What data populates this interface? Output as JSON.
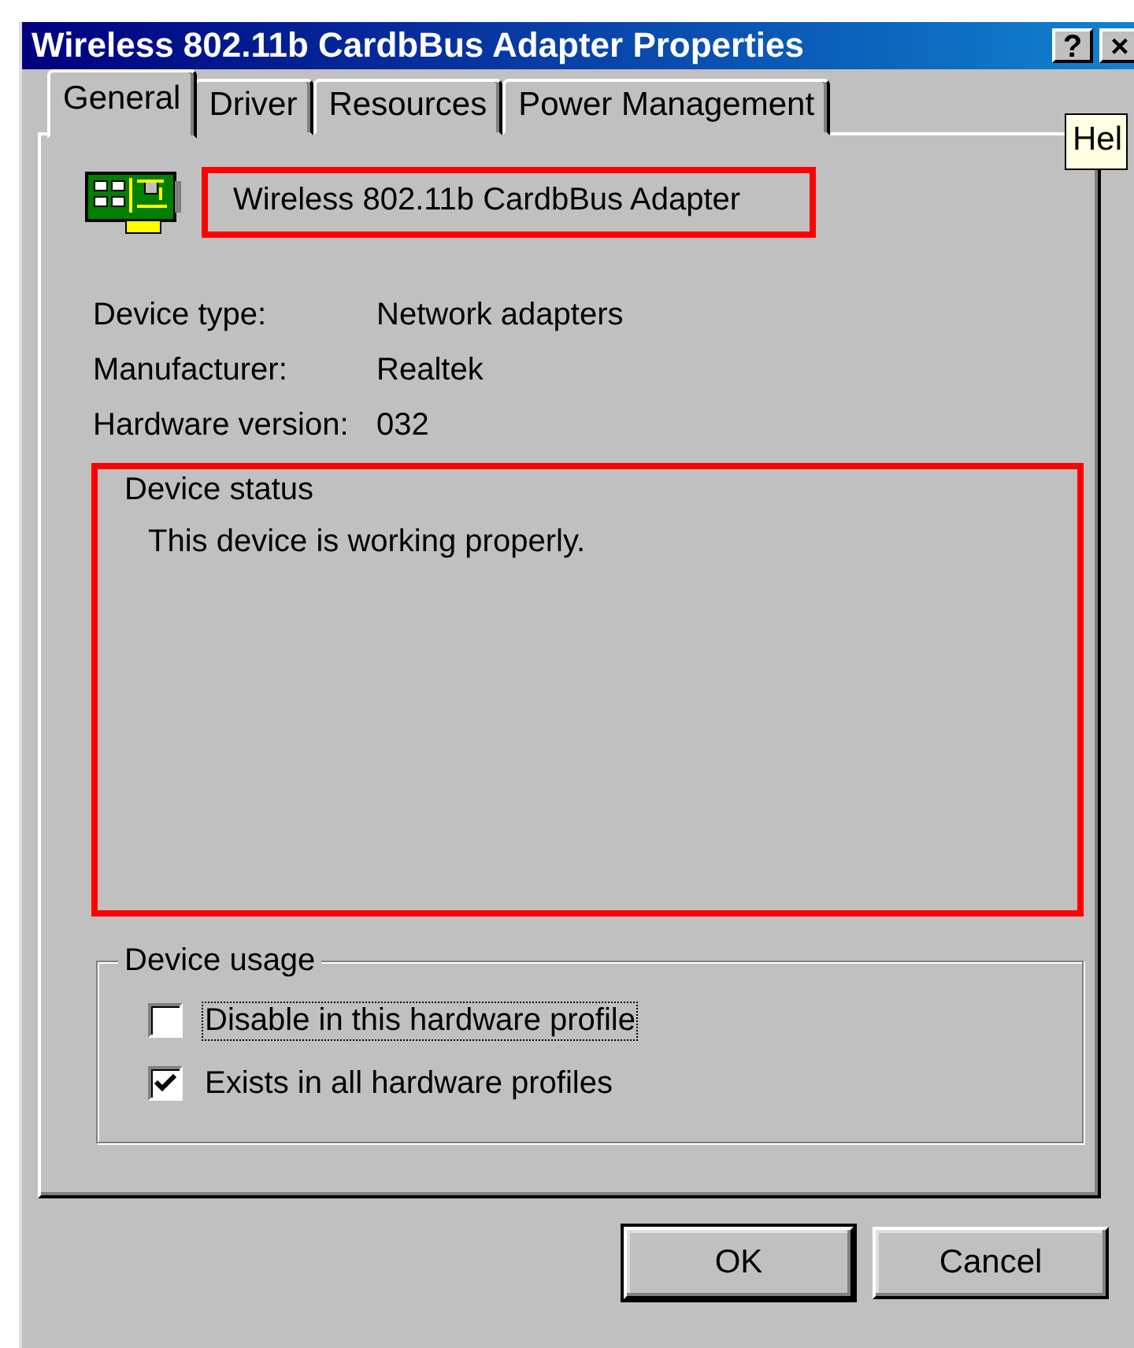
{
  "window": {
    "title": "Wireless 802.11b CardbBus Adapter Properties",
    "title_buttons": [
      "?",
      "×"
    ]
  },
  "tooltip": {
    "text": "Hel"
  },
  "tabs": [
    {
      "label": "General",
      "selected": true
    },
    {
      "label": "Driver",
      "selected": false
    },
    {
      "label": "Resources",
      "selected": false
    },
    {
      "label": "Power Management",
      "selected": false
    }
  ],
  "device": {
    "name": "Wireless 802.11b CardbBus Adapter",
    "highlighted": true
  },
  "properties": [
    {
      "label": "Device type:",
      "value": "Network adapters"
    },
    {
      "label": "Manufacturer:",
      "value": "Realtek"
    },
    {
      "label": "Hardware version:",
      "value": "032"
    }
  ],
  "device_status": {
    "title": "Device status",
    "text": "This device is working properly.",
    "highlighted": true
  },
  "device_usage": {
    "title": "Device usage",
    "options": [
      {
        "label": "Disable in this hardware profile",
        "checked": false,
        "focused": true
      },
      {
        "label": "Exists in all hardware profiles",
        "checked": true,
        "focused": false
      }
    ]
  },
  "buttons": [
    {
      "label": "OK",
      "default": true
    },
    {
      "label": "Cancel",
      "default": false
    }
  ]
}
